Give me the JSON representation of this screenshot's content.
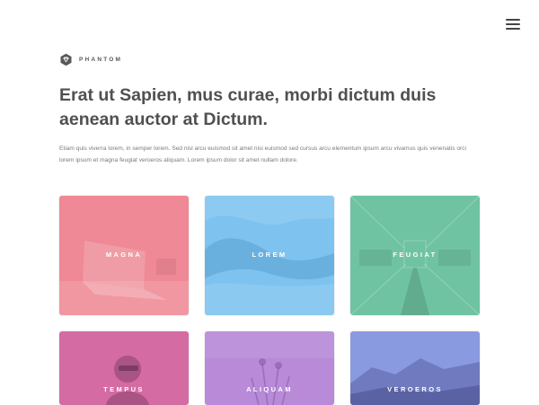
{
  "nav": {
    "menu_icon": "hamburger-icon"
  },
  "brand": {
    "logo_icon": "hexagon-gem-icon",
    "name": "PHANTOM"
  },
  "hero": {
    "headline": "Erat ut Sapien, mus curae, morbi dictum duis aenean auctor at Dictum.",
    "body": "Etiam quis viverra lorem, in semper lorem. Sed nisl arcu euismod sit amet nisi euismod sed cursus arcu elementum ipsum arcu vivamus quis venenatis orci lorem ipsum et magna feugiat veroeros aliquam. Lorem ipsum dolor sit amet nullam dolore."
  },
  "tiles": [
    {
      "label": "MAGNA",
      "color": "#ee8995"
    },
    {
      "label": "LOREM",
      "color": "#7ec3f0"
    },
    {
      "label": "FEUGIAT",
      "color": "#6fc3a2"
    },
    {
      "label": "TEMPUS",
      "color": "#d46ba3"
    },
    {
      "label": "ALIQUAM",
      "color": "#b88ad8"
    },
    {
      "label": "VEROEROS",
      "color": "#8a9ae0"
    }
  ]
}
